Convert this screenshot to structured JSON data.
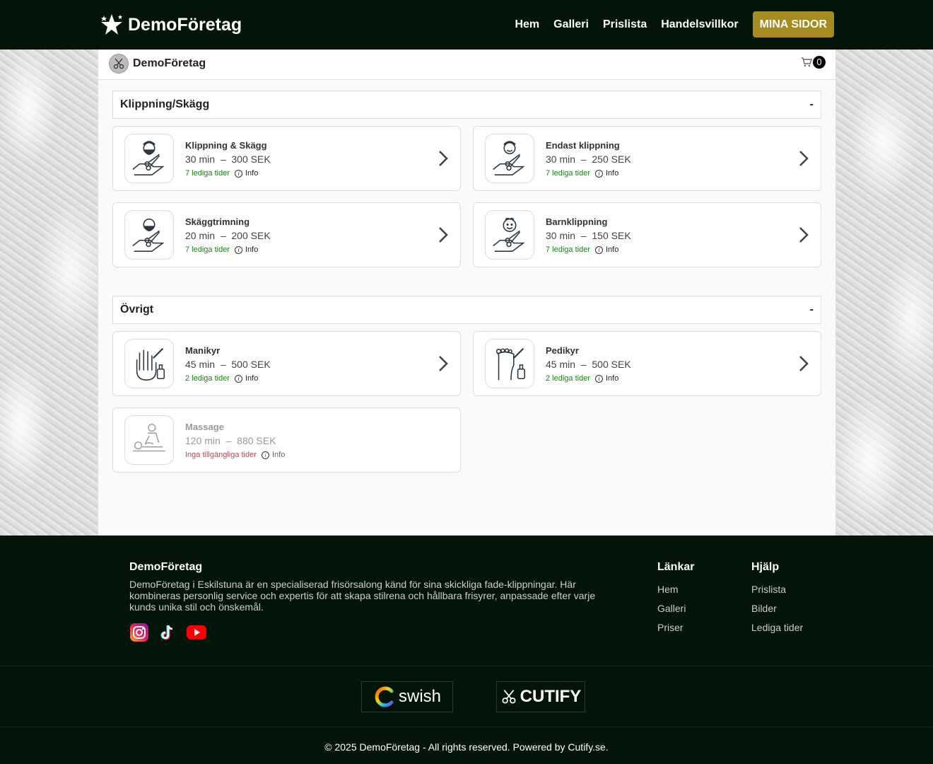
{
  "header": {
    "brand": "DemoFöretag",
    "nav": [
      "Hem",
      "Galleri",
      "Prislista",
      "Handelsvillkor"
    ],
    "cta": "MINA SIDOR"
  },
  "panel": {
    "title": "DemoFöretag",
    "cart_count": "0"
  },
  "sections": [
    {
      "title": "Klippning/Skägg",
      "toggle": "-",
      "services": [
        {
          "name": "Klippning & Skägg",
          "duration": "30 min",
          "sep": "–",
          "price": "300 SEK",
          "availability": "7 lediga tider",
          "info": "Info",
          "icon": "beard-man-scissors-icon"
        },
        {
          "name": "Endast klippning",
          "duration": "30 min",
          "sep": "–",
          "price": "250 SEK",
          "availability": "7 lediga tider",
          "info": "Info",
          "icon": "man-scissors-icon"
        },
        {
          "name": "Skäggtrimning",
          "duration": "20 min",
          "sep": "–",
          "price": "200 SEK",
          "availability": "7 lediga tider",
          "info": "Info",
          "icon": "bald-beard-scissors-icon"
        },
        {
          "name": "Barnklippning",
          "duration": "30 min",
          "sep": "–",
          "price": "150 SEK",
          "availability": "7 lediga tider",
          "info": "Info",
          "icon": "child-scissors-icon"
        }
      ]
    },
    {
      "title": "Övrigt",
      "toggle": "-",
      "services": [
        {
          "name": "Manikyr",
          "duration": "45 min",
          "sep": "–",
          "price": "500 SEK",
          "availability": "2 lediga tider",
          "info": "Info",
          "icon": "hand-nail-polish-icon"
        },
        {
          "name": "Pedikyr",
          "duration": "45 min",
          "sep": "–",
          "price": "500 SEK",
          "availability": "2 lediga tider",
          "info": "Info",
          "icon": "foot-nail-polish-icon"
        },
        {
          "name": "Massage",
          "duration": "120 min",
          "sep": "–",
          "price": "880 SEK",
          "availability": "Inga tillgängliga tider",
          "info": "Info",
          "icon": "massage-icon",
          "disabled": true
        }
      ]
    }
  ],
  "footer": {
    "brand": "DemoFöretag",
    "description": "DemoFöretag i Eskilstuna är en specialiserad frisörsalong känd för sina skickliga fade-klippningar. Här kombineras personlig service och expertis för att skapa stilrena och hållbara frisyrer, anpassade efter varje kunds unika stil och önskemål.",
    "links_title": "Länkar",
    "links": [
      "Hem",
      "Galleri",
      "Priser"
    ],
    "help_title": "Hjälp",
    "help": [
      "Prislista",
      "Bilder",
      "Lediga tider"
    ],
    "swish": "swish",
    "cutify": "CUTIFY",
    "copyright": "© 2025 DemoFöretag - All rights reserved. Powered by Cutify.se."
  }
}
